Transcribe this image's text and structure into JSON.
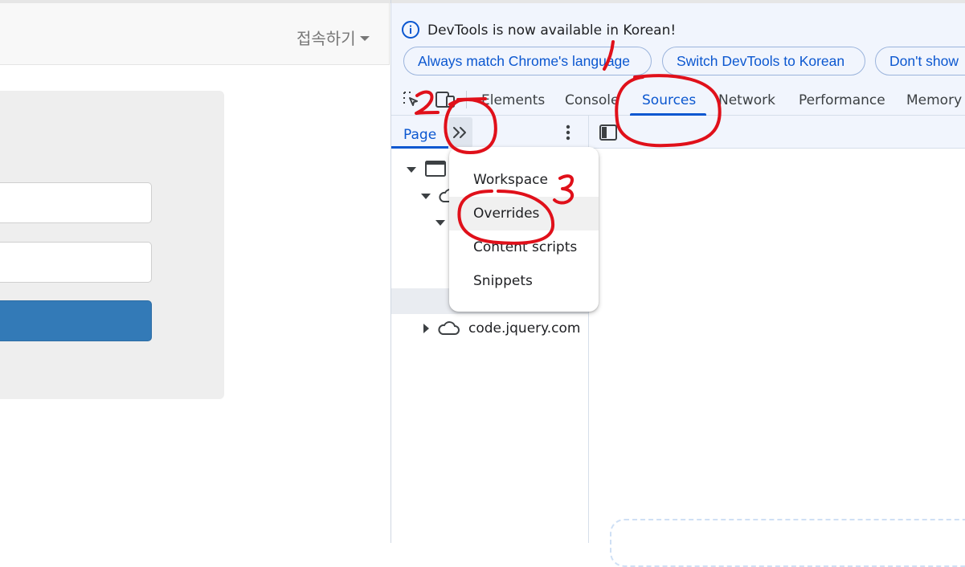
{
  "webpage": {
    "connect_menu": "접속하기"
  },
  "devtools": {
    "infobar": {
      "message": "DevTools is now available in Korean!",
      "buttons": [
        "Always match Chrome's language",
        "Switch DevTools to Korean",
        "Don't show"
      ]
    },
    "tabs": [
      "Elements",
      "Console",
      "Sources",
      "Network",
      "Performance",
      "Memory"
    ],
    "active_tab": "Sources",
    "sources": {
      "subtab": "Page",
      "more_menu": [
        "Workspace",
        "Overrides",
        "Content scripts",
        "Snippets"
      ],
      "highlighted_menu_item": "Overrides",
      "tree": {
        "jquery_label": "code.jquery.com"
      }
    }
  },
  "annotations": [
    "1",
    "2",
    "3"
  ],
  "colors": {
    "accent": "#0b57d0",
    "annotation": "#e0101a",
    "login_button": "#337ab7"
  }
}
